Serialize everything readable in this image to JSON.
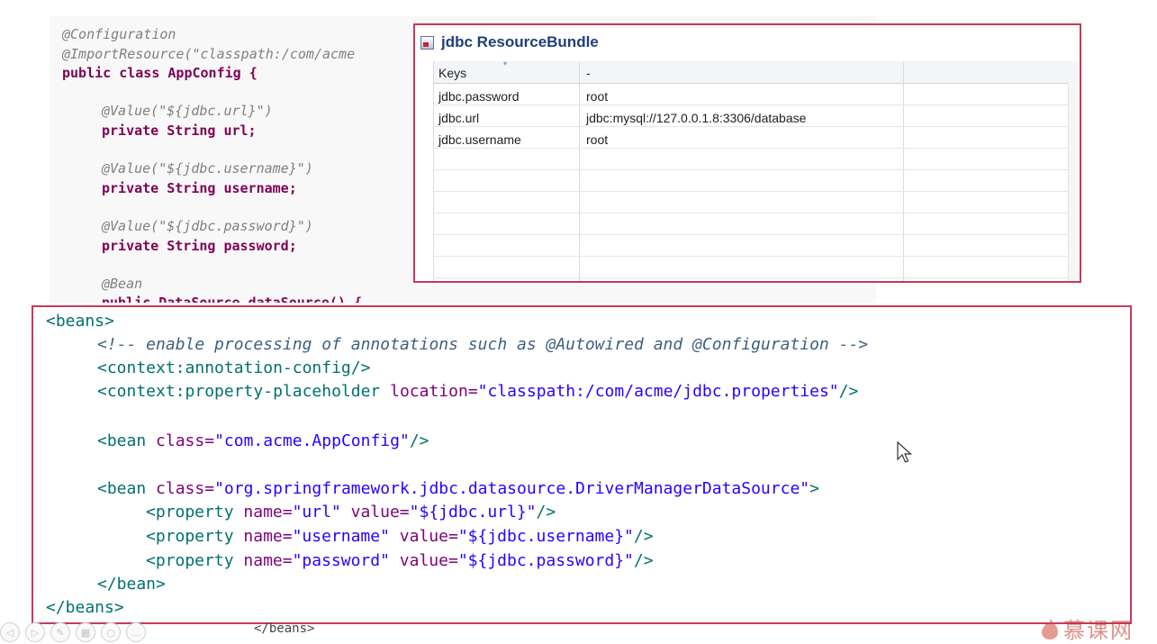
{
  "java_code": {
    "lines": [
      "@Configuration",
      "@ImportResource(\"classpath:/com/acme",
      "public class AppConfig {",
      "@Value(\"${jdbc.url}\")",
      "private String url;",
      "@Value(\"${jdbc.username}\")",
      "private String username;",
      "@Value(\"${jdbc.password}\")",
      "private String password;",
      "@Bean",
      "public DataSource dataSource() {"
    ]
  },
  "resource_bundle": {
    "title": "jdbc ResourceBundle",
    "header_keys": "Keys",
    "header_value": "-",
    "rows": [
      {
        "key": "jdbc.password",
        "value": "root"
      },
      {
        "key": "jdbc.url",
        "value": "jdbc:mysql://127.0.0.1.8:3306/database"
      },
      {
        "key": "jdbc.username",
        "value": "root"
      }
    ]
  },
  "xml_config": {
    "l1": "<beans>",
    "l2": "<!-- enable processing of annotations such as @Autowired and @Configuration -->",
    "l3": "<context:annotation-config/>",
    "l4_tag": "<context:property-placeholder",
    "l4_attr": "location=",
    "l4_val": "\"classpath:/com/acme/jdbc.properties\"",
    "l4_end": "/>",
    "l5_tag": "<bean",
    "l5_attr": "class=",
    "l5_val": "\"com.acme.AppConfig\"",
    "l5_end": "/>",
    "l6_tag": "<bean",
    "l6_attr": "class=",
    "l6_val": "\"org.springframework.jdbc.datasource.DriverManagerDataSource\"",
    "l6_end": ">",
    "props": [
      {
        "name_val": "\"url\"",
        "value_val": "\"${jdbc.url}\""
      },
      {
        "name_val": "\"username\"",
        "value_val": "\"${jdbc.username}\""
      },
      {
        "name_val": "\"password\"",
        "value_val": "\"${jdbc.password}\""
      }
    ],
    "prop_tag": "<property",
    "name_attr": "name=",
    "value_attr": "value=",
    "prop_end": "/>",
    "l10": "</bean>",
    "l11": "</beans>"
  },
  "under_text": "</beans>",
  "watermark": "慕课网",
  "colors": {
    "frame": "#c8385a",
    "xml_tag": "#007070",
    "xml_attr": "#7f007f",
    "xml_value": "#2a00ff",
    "java_keyword": "#7f0055"
  }
}
